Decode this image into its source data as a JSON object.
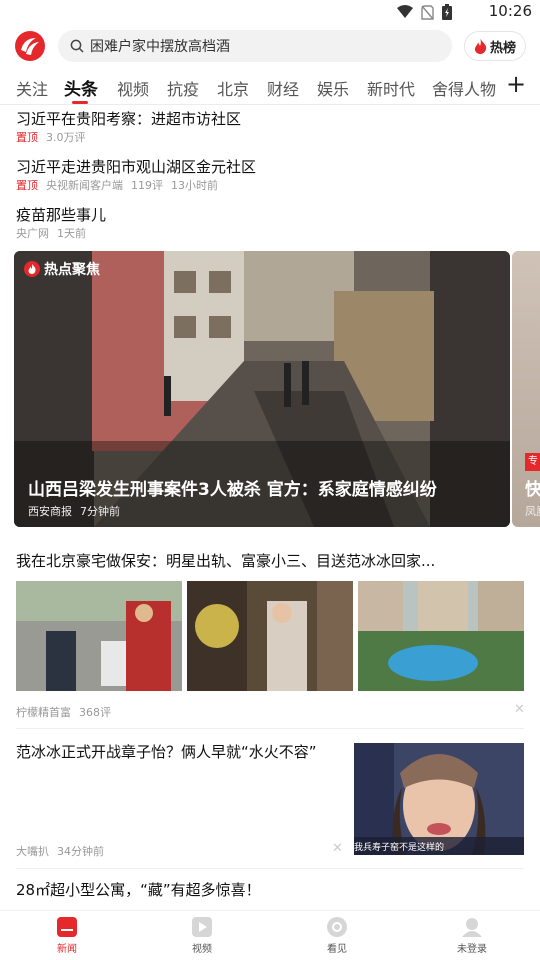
{
  "status_bar": {
    "time": "10:26"
  },
  "header": {
    "search_text": "困难户家中摆放高档酒",
    "hot_button_label": "热榜"
  },
  "tabs": [
    "关注",
    "头条",
    "视频",
    "抗疫",
    "北京",
    "财经",
    "娱乐",
    "新时代",
    "舍得人物"
  ],
  "active_tab": "头条",
  "news": [
    {
      "title": "习近平在贵阳考察：进超市访社区",
      "pin": "置顶",
      "comments": "3.0万评"
    },
    {
      "title": "习近平走进贵阳市观山湖区金元社区",
      "pin": "置顶",
      "source": "央视新闻客户端",
      "comments": "119评",
      "time": "13小时前"
    },
    {
      "title": "疫苗那些事儿",
      "source": "央广网",
      "time": "1天前"
    }
  ],
  "hot_focus": {
    "badge": "热点聚焦",
    "title": "山西吕梁发生刑事案件3人被杀 官方：系家庭情感纠纷",
    "source": "西安商报",
    "time": "7分钟前",
    "next_tag": "专",
    "next_title_fragment": "快",
    "next_source_fragment": "凤凰"
  },
  "article_three_images": {
    "title": "我在北京豪宅做保安：明星出轨、富豪小三、目送范冰冰回家...",
    "source": "柠檬精首富",
    "comments": "368评"
  },
  "article_right_image": {
    "title": "范冰冰正式开战章子怡？俩人早就“水火不容”",
    "source": "大嘴扒",
    "time": "34分钟前",
    "image_caption": "我兵寿子窑不是这样的"
  },
  "article_next": {
    "title": "28㎡超小型公寓，“藏”有超多惊喜！"
  },
  "bottom_nav": [
    {
      "label": "新闻",
      "icon": "news-icon",
      "active": true
    },
    {
      "label": "视频",
      "icon": "video-icon",
      "active": false
    },
    {
      "label": "看见",
      "icon": "eye-icon",
      "active": false
    },
    {
      "label": "未登录",
      "icon": "user-icon",
      "active": false
    }
  ],
  "colors": {
    "accent": "#e5282c",
    "text": "#111111",
    "meta": "#999999"
  }
}
